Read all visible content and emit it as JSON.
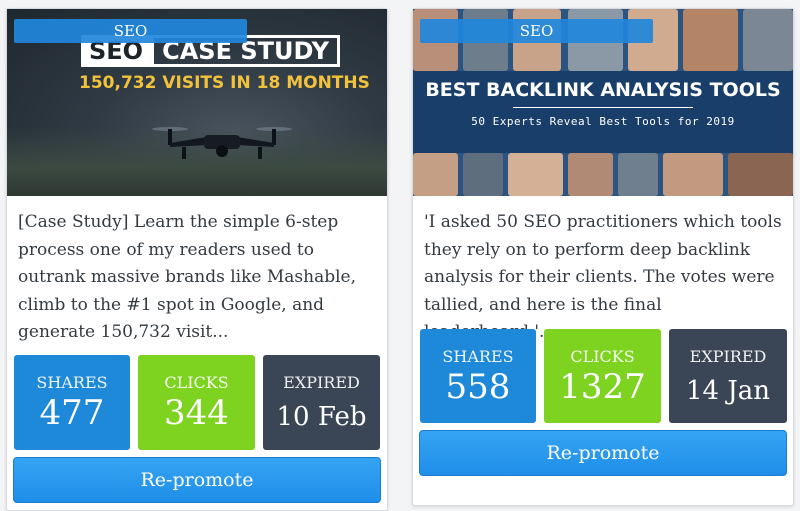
{
  "cards": [
    {
      "badge": "SEO",
      "hero": {
        "title_seo": "SEO",
        "title_main": "CASE STUDY",
        "subtitle": "150,732 VISITS IN 18 MONTHS"
      },
      "description": "[Case Study] Learn the simple 6-step process one of my readers used to outrank massive brands like Mashable, climb to the #1 spot in Google, and generate 150,732 visit...",
      "stats": {
        "shares_label": "SHARES",
        "shares": "477",
        "clicks_label": "CLICKS",
        "clicks": "344",
        "expired_label": "EXPIRED",
        "expired": "10 Feb"
      },
      "button": "Re-promote"
    },
    {
      "badge": "SEO",
      "hero": {
        "title": "BEST BACKLINK ANALYSIS TOOLS",
        "subtitle": "50 Experts Reveal Best Tools for 2019"
      },
      "description": "'I asked 50 SEO practitioners which tools they rely on to perform deep backlink analysis for their clients. The votes were tallied, and here is the final leaderboard.'...",
      "stats": {
        "shares_label": "SHARES",
        "shares": "558",
        "clicks_label": "CLICKS",
        "clicks": "1327",
        "expired_label": "EXPIRED",
        "expired": "14 Jan"
      },
      "button": "Re-promote"
    }
  ],
  "colors": {
    "shares": "#1e88d9",
    "clicks": "#7ed321",
    "expired": "#3a4655",
    "button": "#2196f3",
    "title_accent": "#f2c23b"
  }
}
